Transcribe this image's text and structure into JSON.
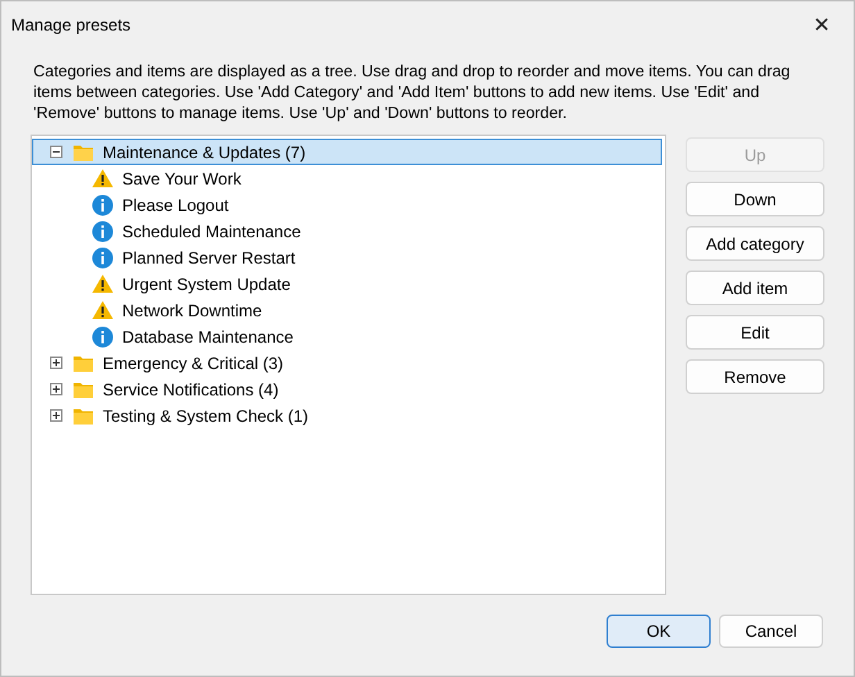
{
  "window": {
    "title": "Manage presets",
    "close": "✕"
  },
  "description": "Categories and items are displayed as a tree. Use drag and drop to reorder and move items. You can drag items between categories. Use 'Add Category' and 'Add Item' buttons to add new items. Use 'Edit' and 'Remove' buttons to manage items. Use 'Up' and 'Down' buttons to reorder.",
  "tree": [
    {
      "label": "Maintenance & Updates (7)",
      "expanded": true,
      "selected": true,
      "children": [
        {
          "label": "Save Your Work",
          "kind": "warning"
        },
        {
          "label": "Please Logout",
          "kind": "info"
        },
        {
          "label": "Scheduled Maintenance",
          "kind": "info"
        },
        {
          "label": "Planned Server Restart",
          "kind": "info"
        },
        {
          "label": "Urgent System Update",
          "kind": "warning"
        },
        {
          "label": "Network Downtime",
          "kind": "warning"
        },
        {
          "label": "Database Maintenance",
          "kind": "info"
        }
      ]
    },
    {
      "label": "Emergency & Critical (3)",
      "expanded": false,
      "selected": false
    },
    {
      "label": "Service Notifications (4)",
      "expanded": false,
      "selected": false
    },
    {
      "label": "Testing & System Check (1)",
      "expanded": false,
      "selected": false
    }
  ],
  "side_buttons": [
    {
      "label": "Up",
      "disabled": true
    },
    {
      "label": "Down",
      "disabled": false
    },
    {
      "label": "Add category",
      "disabled": false
    },
    {
      "label": "Add item",
      "disabled": false
    },
    {
      "label": "Edit",
      "disabled": false
    },
    {
      "label": "Remove",
      "disabled": false
    }
  ],
  "footer_buttons": [
    {
      "label": "OK",
      "default": true
    },
    {
      "label": "Cancel",
      "default": false
    }
  ]
}
